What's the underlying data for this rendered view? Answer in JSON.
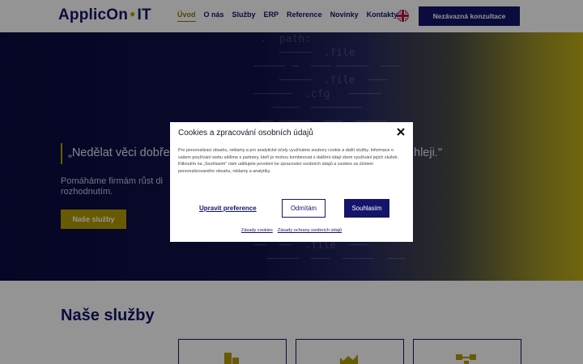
{
  "header": {
    "logo_text": "ApplicOn",
    "logo_suffix": "IT",
    "nav": [
      "Úvod",
      "O nás",
      "Služby",
      "ERP",
      "Reference",
      "Novinky",
      "Kontakty"
    ],
    "cta": "Nezávazná konzultace"
  },
  "hero": {
    "quote": "„Nedělat věci dobře",
    "quote_end": "hleji.\"",
    "tagline_line1": "Pomáháme firmám růst di",
    "tagline_line2": "rozhodnutím.",
    "button": "Naše služby"
  },
  "services": {
    "title": "Naše služby"
  },
  "cookie_modal": {
    "title": "Cookies a zpracování osobních údajů",
    "text": "Pro personalizaci obsahu, reklamy a pro analytické účely využíváme soubory cookie a další služby. Informace o vašem používání webu sdílíme s partnery, kteří je mohou kombinovat s dalšími údaji všem využívání jejich služeb. Kliknutím na „Souhlasím\" nám udělujete povolení ke zpracování osobních údajů a cookies za účelem personalizovaného obsahu, reklamy a analytiky.",
    "preferences": "Upravit preference",
    "deny": "Odmítám",
    "accept": "Souhlasím",
    "link_cookies": "Zásady cookies",
    "link_privacy": "Zásady ochrany osobních údajů"
  },
  "colors": {
    "brand": "#14146b",
    "accent": "#b49c00"
  }
}
